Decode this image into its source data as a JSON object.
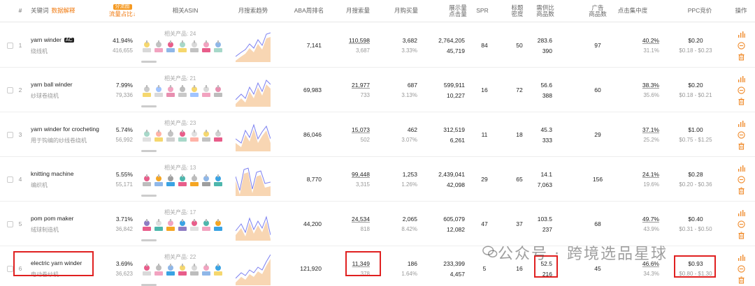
{
  "header": {
    "index": "#",
    "keyword": "关键词",
    "keyword_link": "数据解释",
    "traffic_badge": "分流图",
    "traffic": "流量占比↓",
    "asin": "相关ASIN",
    "trend": "月搜索趋势",
    "aba": "ABA周排名",
    "monthly_search": "月搜索量",
    "monthly_buy": "月购买量",
    "impressions": "展示量",
    "clicks": "点击量",
    "spr": "SPR",
    "title_density": "标题",
    "title_density2": "密度",
    "supply_demand": "需供比",
    "product_count": "商品数",
    "ad": "广告",
    "ad2": "商品数",
    "click_conc": "点击集中度",
    "ppc": "PPC竞价",
    "ops": "操作"
  },
  "rows": [
    {
      "idx": "1",
      "kw": "yarn winder",
      "ac": "AC",
      "kw_zh": "绕线机",
      "traffic": "41.94%",
      "traffic_sub": "416,655",
      "asin_label": "相关产品: 24",
      "aba": "7,141",
      "search": "110,598",
      "search_sub": "3,687",
      "buy": "3,682",
      "buy_sub": "3.33%",
      "impr": "2,764,205",
      "clicks": "45,719",
      "spr": "84",
      "title": "50",
      "sd": "283.6",
      "sd_sub": "390",
      "ad": "97",
      "cc": "40.2%",
      "cc_sub": "31.1%",
      "ppc": "$0.20",
      "ppc_sub": "$0.18 - $0.23"
    },
    {
      "idx": "2",
      "kw": "yarn ball winder",
      "ac": "",
      "kw_zh": "纱球卷绕机",
      "traffic": "7.99%",
      "traffic_sub": "79,336",
      "asin_label": "相关产品: 21",
      "aba": "69,983",
      "search": "21,977",
      "search_sub": "733",
      "buy": "687",
      "buy_sub": "3.13%",
      "impr": "599,911",
      "clicks": "10,227",
      "spr": "16",
      "title": "72",
      "sd": "56.6",
      "sd_sub": "388",
      "ad": "60",
      "cc": "38.3%",
      "cc_sub": "35.6%",
      "ppc": "$0.20",
      "ppc_sub": "$0.18 - $0.21"
    },
    {
      "idx": "3",
      "kw": "yarn winder for crocheting",
      "ac": "",
      "kw_zh": "用于钩编的纱线卷绕机",
      "traffic": "5.74%",
      "traffic_sub": "56,992",
      "asin_label": "相关产品: 23",
      "aba": "86,046",
      "search": "15,073",
      "search_sub": "502",
      "buy": "462",
      "buy_sub": "3.07%",
      "impr": "312,519",
      "clicks": "6,261",
      "spr": "11",
      "title": "18",
      "sd": "45.3",
      "sd_sub": "333",
      "ad": "29",
      "cc": "37.1%",
      "cc_sub": "25.2%",
      "ppc": "$1.00",
      "ppc_sub": "$0.75 - $1.25"
    },
    {
      "idx": "4",
      "kw": "knitting machine",
      "ac": "",
      "kw_zh": "编织机",
      "traffic": "5.55%",
      "traffic_sub": "55,171",
      "asin_label": "相关产品: 13",
      "aba": "8,770",
      "search": "99,448",
      "search_sub": "3,315",
      "buy": "1,253",
      "buy_sub": "1.26%",
      "impr": "2,439,041",
      "clicks": "42,098",
      "spr": "29",
      "title": "65",
      "sd": "14.1",
      "sd_sub": "7,063",
      "ad": "156",
      "cc": "24.1%",
      "cc_sub": "19.6%",
      "ppc": "$0.28",
      "ppc_sub": "$0.20 - $0.36"
    },
    {
      "idx": "5",
      "kw": "pom pom maker",
      "ac": "",
      "kw_zh": "绒球制造机",
      "traffic": "3.71%",
      "traffic_sub": "36,842",
      "asin_label": "相关产品: 17",
      "aba": "44,200",
      "search": "24,534",
      "search_sub": "818",
      "buy": "2,065",
      "buy_sub": "8.42%",
      "impr": "605,079",
      "clicks": "12,082",
      "spr": "47",
      "title": "37",
      "sd": "103.5",
      "sd_sub": "237",
      "ad": "68",
      "cc": "49.7%",
      "cc_sub": "43.9%",
      "ppc": "$0.40",
      "ppc_sub": "$0.31 - $0.50"
    },
    {
      "idx": "6",
      "kw": "electric yarn winder",
      "ac": "",
      "kw_zh": "电动卷纱机",
      "traffic": "3.69%",
      "traffic_sub": "36,623",
      "asin_label": "相关产品: 22",
      "aba": "121,920",
      "search": "11,349",
      "search_sub": "378",
      "buy": "186",
      "buy_sub": "1.64%",
      "impr": "233,399",
      "clicks": "4,457",
      "spr": "5",
      "title": "16",
      "sd": "52.5",
      "sd_sub": "216",
      "ad": "45",
      "cc": "46.6%",
      "cc_sub": "34.3%",
      "ppc": "$0.93",
      "ppc_sub": "$0.80 - $1.30"
    }
  ],
  "watermark": "公众号 · 跨境选品星球",
  "colors": {
    "accent": "#f07a10",
    "highlight": "#e02020",
    "trend_line": "#7b7ff0",
    "trend_fill": "#f6c89a"
  }
}
